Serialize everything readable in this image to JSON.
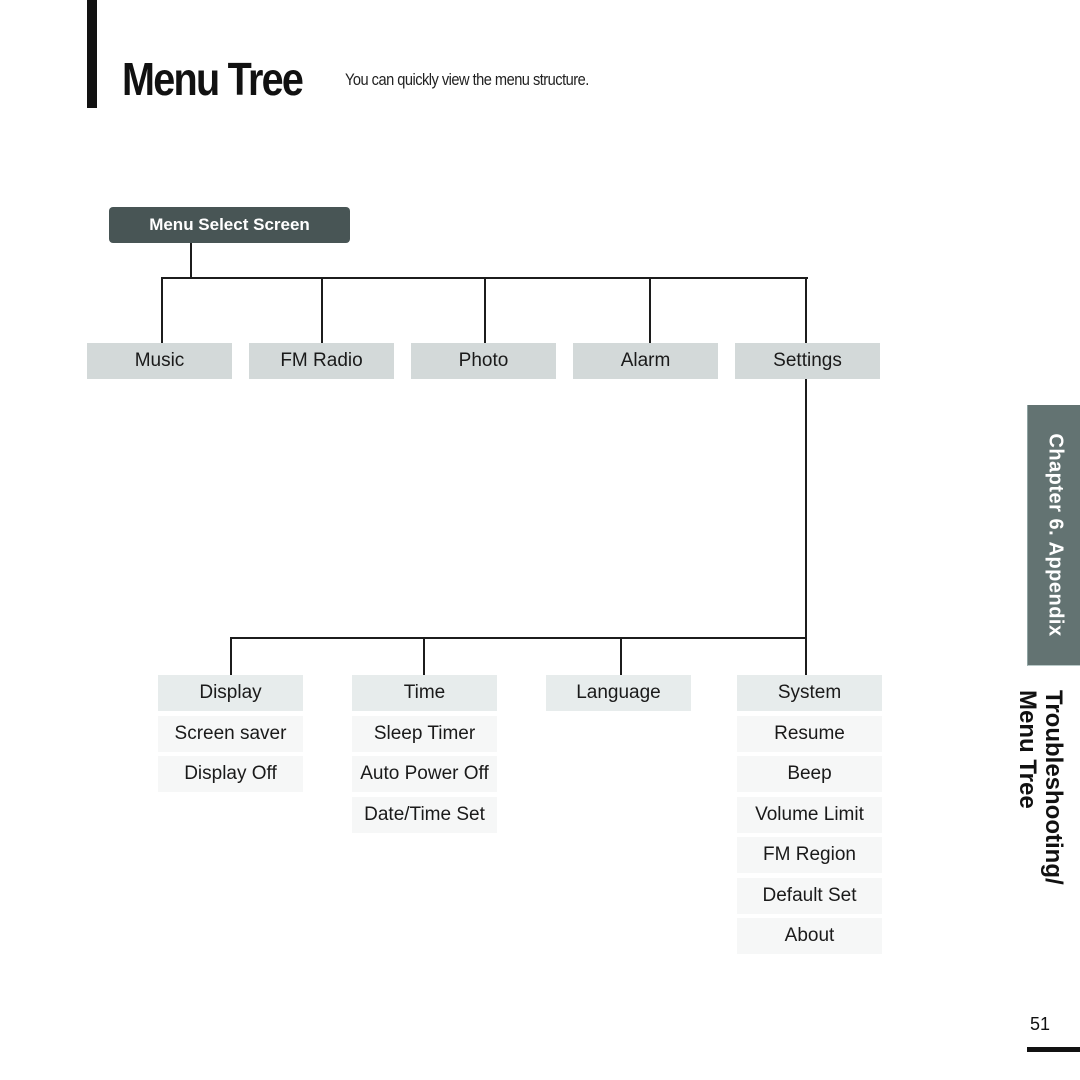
{
  "header": {
    "title": "Menu Tree",
    "subtitle": "You can quickly view the menu structure."
  },
  "tree": {
    "root": "Menu Select Screen",
    "level1": [
      "Music",
      "FM Radio",
      "Photo",
      "Alarm",
      "Settings"
    ],
    "settings_children": [
      {
        "label": "Display",
        "children": [
          "Screen saver",
          "Display Off"
        ]
      },
      {
        "label": "Time",
        "children": [
          "Sleep Timer",
          "Auto Power Off",
          "Date/Time Set"
        ]
      },
      {
        "label": "Language",
        "children": []
      },
      {
        "label": "System",
        "children": [
          "Resume",
          "Beep",
          "Volume Limit",
          "FM Region",
          "Default Set",
          "About"
        ]
      }
    ]
  },
  "side": {
    "chapter_tab": "Chapter 6.  Appendix",
    "section_title_line1": "Troubleshooting/",
    "section_title_line2": "Menu Tree"
  },
  "footer": {
    "page_number": "51"
  },
  "colors": {
    "root_box": "#485555",
    "level1_box": "#d3d9d9",
    "level2_box": "#e7ecec",
    "level3_box": "#f6f7f7",
    "chapter_tab": "#637372"
  }
}
